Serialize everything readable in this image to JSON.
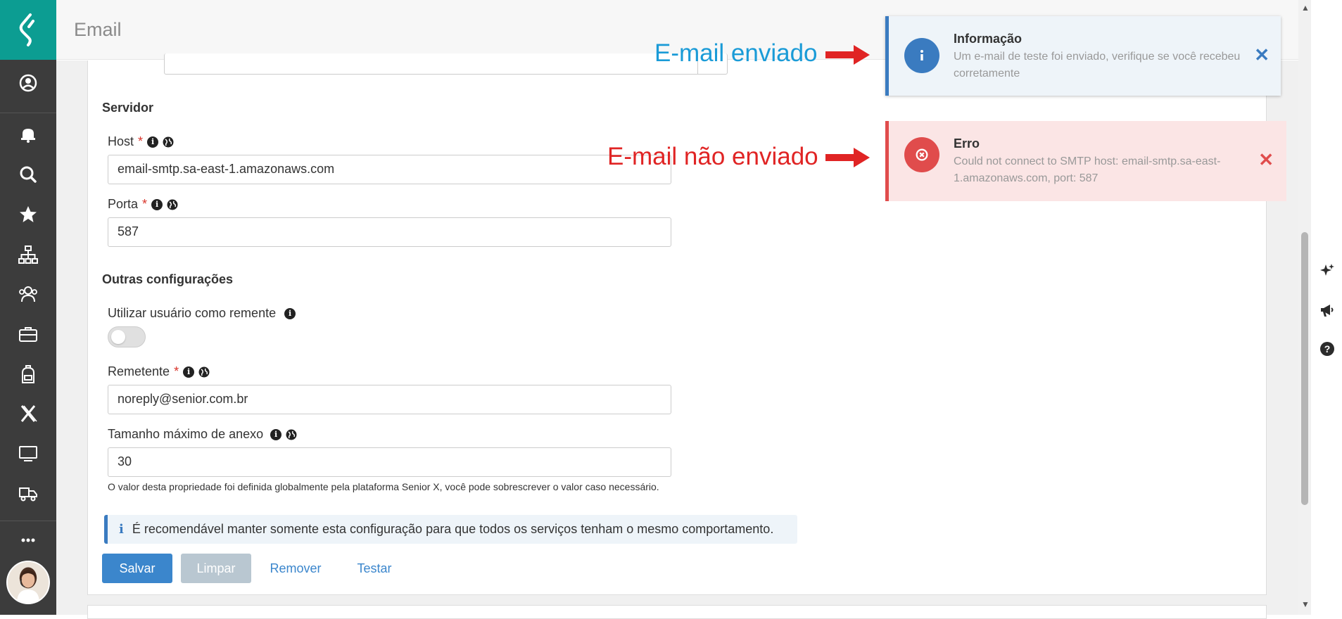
{
  "header": {
    "title": "Email"
  },
  "sections": {
    "servidor": "Servidor",
    "outras": "Outras configurações"
  },
  "fields": {
    "host": {
      "label": "Host",
      "required": "*",
      "value": "email-smtp.sa-east-1.amazonaws.com"
    },
    "porta": {
      "label": "Porta",
      "required": "*",
      "value": "587"
    },
    "utilizar_usuario": {
      "label": "Utilizar usuário como remente",
      "checked": false
    },
    "remetente": {
      "label": "Remetente",
      "required": "*",
      "value": "noreply@senior.com.br"
    },
    "tamanho": {
      "label": "Tamanho máximo de anexo",
      "value": "30"
    }
  },
  "help_text": "O valor desta propriedade foi definida globalmente pela plataforma Senior X, você pode sobrescrever o valor caso necessário.",
  "info_banner": "É recomendável manter somente esta configuração para que todos os serviços tenham o mesmo comportamento.",
  "buttons": {
    "save": "Salvar",
    "clear": "Limpar",
    "remove": "Remover",
    "test": "Testar"
  },
  "toasts": {
    "info": {
      "title": "Informação",
      "message": "Um e-mail de teste foi enviado, verifique se você recebeu corretamente",
      "color": "#3a7bc0"
    },
    "error": {
      "title": "Erro",
      "message": "Could not connect to SMTP host: email-smtp.sa-east-1.amazonaws.com, port: 587",
      "color": "#e04c4c"
    }
  },
  "annotations": {
    "sent": "E-mail enviado",
    "not_sent": "E-mail não enviado",
    "sent_color": "#1a9bd7",
    "not_sent_color": "#e02424"
  },
  "sidebar": {
    "items": [
      "user-circle-icon",
      "bell-icon",
      "search-icon",
      "star-icon",
      "org-chart-icon",
      "team-icon",
      "briefcase-icon",
      "backpack-icon",
      "x-icon",
      "monitor-icon",
      "truck-icon",
      "more-icon"
    ]
  },
  "colors": {
    "brand": "#0c9d92",
    "sidebar": "#3c3c3c",
    "primary": "#3b86cc"
  }
}
